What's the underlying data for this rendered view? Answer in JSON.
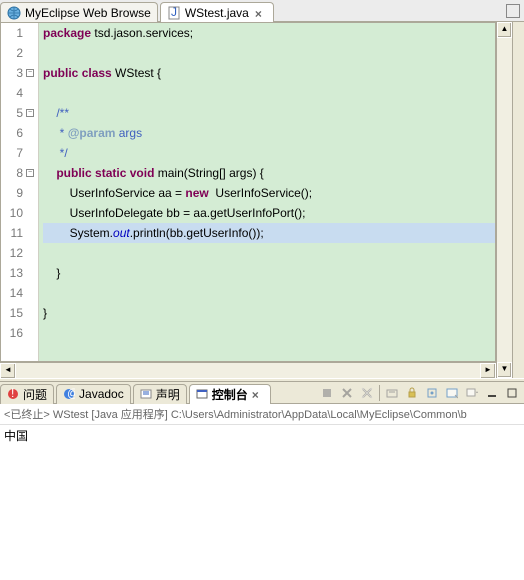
{
  "topTabs": {
    "browser": {
      "label": "MyEclipse Web Browse"
    },
    "editor": {
      "label": "WStest.java"
    }
  },
  "code": {
    "lines": [
      {
        "n": 1,
        "html": "<span class='kw'>package</span> tsd.jason.services;"
      },
      {
        "n": 2,
        "html": ""
      },
      {
        "n": 3,
        "fold": "-",
        "html": "<span class='kw'>public</span> <span class='kw'>class</span> WStest {"
      },
      {
        "n": 4,
        "html": ""
      },
      {
        "n": 5,
        "fold": "-",
        "html": "    <span class='cm'>/**</span>"
      },
      {
        "n": 6,
        "html": "<span class='cm'>     * </span><span class='cmtag'>@param</span><span class='cm'> args</span>"
      },
      {
        "n": 7,
        "html": "<span class='cm'>     */</span>"
      },
      {
        "n": 8,
        "fold": "-",
        "html": "    <span class='kw'>public</span> <span class='kw'>static</span> <span class='kw'>void</span> main(String[] args) {"
      },
      {
        "n": 9,
        "html": "        UserInfoService aa = <span class='kw'>new</span>  UserInfoService();"
      },
      {
        "n": 10,
        "html": "        UserInfoDelegate bb = aa.getUserInfoPort();"
      },
      {
        "n": 11,
        "cursor": true,
        "html": "        System.<span class='st'>out</span>.println(bb.getUserInfo());"
      },
      {
        "n": 12,
        "html": ""
      },
      {
        "n": 13,
        "html": "    }"
      },
      {
        "n": 14,
        "html": ""
      },
      {
        "n": 15,
        "html": "}"
      },
      {
        "n": 16,
        "html": ""
      }
    ]
  },
  "bottomTabs": {
    "problems": "问题",
    "javadoc": "Javadoc",
    "declaration": "声明",
    "console": "控制台"
  },
  "console": {
    "header": "<已终止> WStest [Java 应用程序] C:\\Users\\Administrator\\AppData\\Local\\MyEclipse\\Common\\b",
    "output": "中国"
  }
}
